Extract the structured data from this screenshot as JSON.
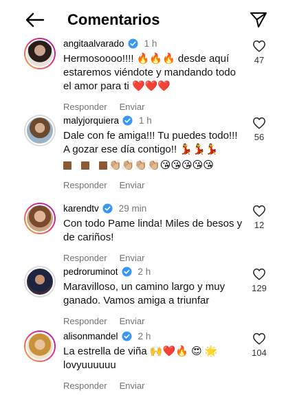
{
  "header": {
    "title": "Comentarios",
    "back_icon": "arrow-left-icon",
    "share_icon": "send-paper-plane-icon"
  },
  "comments": [
    {
      "username": "angitaalvarado",
      "verified": true,
      "time": "1 h",
      "text": "Hermosoooo!!!! 🔥🔥🔥 desde aquí estaremos viéndote y mandando todo el amor para ti ❤️❤️❤️",
      "reply": "Responder",
      "send": "Enviar",
      "likes": "47"
    },
    {
      "username": "malyjorquiera",
      "verified": true,
      "time": "1 h",
      "text": "Dale con fe amiga!!! Tu puedes todo!!! A gozar ese día contigo!! 💃💃💃",
      "emoji_line": "👏🏼👏🏼👏🏼👏🏼😘😘😘😘😘",
      "reply": "Responder",
      "send": "Enviar",
      "likes": "56"
    },
    {
      "username": "karendtv",
      "verified": true,
      "time": "29 min",
      "text": "Con todo Pame linda! Miles de besos y de cariños!",
      "reply": "Responder",
      "send": "Enviar",
      "likes": "12"
    },
    {
      "username": "pedroruminot",
      "verified": true,
      "time": "2 h",
      "text": "Maravilloso, un camino largo y muy ganado. Vamos amiga a triunfar",
      "reply": "Responder",
      "send": "Enviar",
      "likes": "129"
    },
    {
      "username": "alisonmandel",
      "verified": true,
      "time": "2 h",
      "text": "La estrella de viña 🙌❤️🔥 😍 🌟 lovyuuuuuu",
      "reply": "Responder",
      "send": "Enviar",
      "likes": "104"
    }
  ],
  "colors": {
    "verified": "#3897f0",
    "muted": "#737373",
    "story_ring_start": "#f9b233",
    "story_ring_end": "#9b1fb4"
  }
}
